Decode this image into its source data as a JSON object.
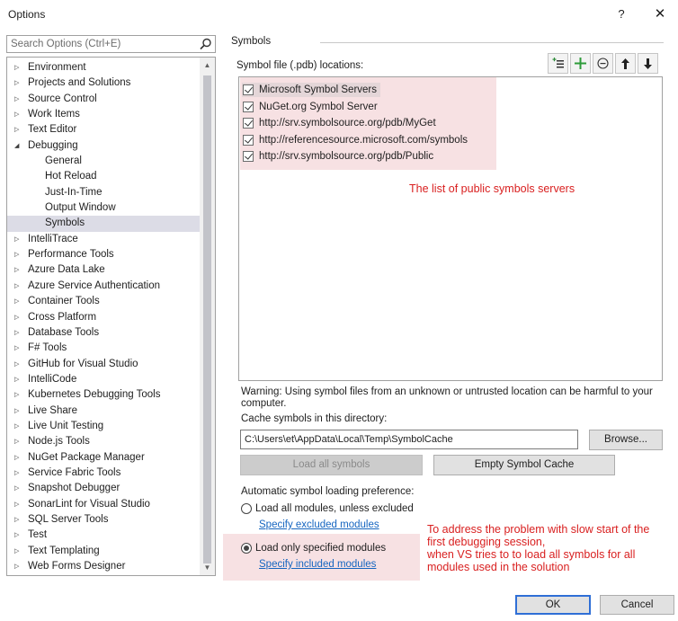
{
  "window": {
    "title": "Options",
    "help": "?",
    "close": "✕"
  },
  "search": {
    "placeholder": "Search Options (Ctrl+E)"
  },
  "tree": {
    "items": [
      {
        "label": "Environment",
        "arrow": "▷",
        "level": 0
      },
      {
        "label": "Projects and Solutions",
        "arrow": "▷",
        "level": 0
      },
      {
        "label": "Source Control",
        "arrow": "▷",
        "level": 0
      },
      {
        "label": "Work Items",
        "arrow": "▷",
        "level": 0
      },
      {
        "label": "Text Editor",
        "arrow": "▷",
        "level": 0
      },
      {
        "label": "Debugging",
        "arrow": "◢",
        "level": 0
      },
      {
        "label": "General",
        "arrow": "",
        "level": 1
      },
      {
        "label": "Hot Reload",
        "arrow": "",
        "level": 1
      },
      {
        "label": "Just-In-Time",
        "arrow": "",
        "level": 1
      },
      {
        "label": "Output Window",
        "arrow": "",
        "level": 1
      },
      {
        "label": "Symbols",
        "arrow": "",
        "level": 1,
        "selected": true
      },
      {
        "label": "IntelliTrace",
        "arrow": "▷",
        "level": 0
      },
      {
        "label": "Performance Tools",
        "arrow": "▷",
        "level": 0
      },
      {
        "label": "Azure Data Lake",
        "arrow": "▷",
        "level": 0
      },
      {
        "label": "Azure Service Authentication",
        "arrow": "▷",
        "level": 0
      },
      {
        "label": "Container Tools",
        "arrow": "▷",
        "level": 0
      },
      {
        "label": "Cross Platform",
        "arrow": "▷",
        "level": 0
      },
      {
        "label": "Database Tools",
        "arrow": "▷",
        "level": 0
      },
      {
        "label": "F# Tools",
        "arrow": "▷",
        "level": 0
      },
      {
        "label": "GitHub for Visual Studio",
        "arrow": "▷",
        "level": 0
      },
      {
        "label": "IntelliCode",
        "arrow": "▷",
        "level": 0
      },
      {
        "label": "Kubernetes Debugging Tools",
        "arrow": "▷",
        "level": 0
      },
      {
        "label": "Live Share",
        "arrow": "▷",
        "level": 0
      },
      {
        "label": "Live Unit Testing",
        "arrow": "▷",
        "level": 0
      },
      {
        "label": "Node.js Tools",
        "arrow": "▷",
        "level": 0
      },
      {
        "label": "NuGet Package Manager",
        "arrow": "▷",
        "level": 0
      },
      {
        "label": "Service Fabric Tools",
        "arrow": "▷",
        "level": 0
      },
      {
        "label": "Snapshot Debugger",
        "arrow": "▷",
        "level": 0
      },
      {
        "label": "SonarLint for Visual Studio",
        "arrow": "▷",
        "level": 0
      },
      {
        "label": "SQL Server Tools",
        "arrow": "▷",
        "level": 0
      },
      {
        "label": "Test",
        "arrow": "▷",
        "level": 0
      },
      {
        "label": "Text Templating",
        "arrow": "▷",
        "level": 0
      },
      {
        "label": "Web Forms Designer",
        "arrow": "▷",
        "level": 0
      }
    ]
  },
  "panel": {
    "section_title": "Symbols",
    "locations_label": "Symbol file (.pdb) locations:",
    "symbol_servers": [
      {
        "label": "Microsoft Symbol Servers",
        "checked": true
      },
      {
        "label": "NuGet.org Symbol Server",
        "checked": true
      },
      {
        "label": "http://srv.symbolsource.org/pdb/MyGet",
        "checked": true
      },
      {
        "label": "http://referencesource.microsoft.com/symbols",
        "checked": true
      },
      {
        "label": "http://srv.symbolsource.org/pdb/Public",
        "checked": true
      }
    ],
    "annotation_servers": "The list of public symbols servers",
    "warning": "Warning: Using symbol files from an unknown or untrusted location can be harmful to your computer.",
    "cache_label": "Cache symbols in this directory:",
    "cache_value": "C:\\Users\\et\\AppData\\Local\\Temp\\SymbolCache",
    "browse": "Browse...",
    "load_all": "Load all symbols",
    "empty_cache": "Empty Symbol Cache",
    "auto_label": "Automatic symbol loading preference:",
    "option_all": "Load all modules, unless excluded",
    "link_excluded": "Specify excluded modules",
    "option_only": "Load only specified modules",
    "link_included": "Specify included modules",
    "annotation_slow": [
      "To address  the problem with slow start of the",
      "first debugging session,",
      "when VS tries to  to load all symbols for all",
      "modules used in the solution"
    ]
  },
  "footer": {
    "ok": "OK",
    "cancel": "Cancel"
  },
  "colors": {
    "annotation": "#d92020",
    "highlight": "#f7e1e3",
    "link": "#1565c0",
    "selected": "#dcdce6"
  }
}
